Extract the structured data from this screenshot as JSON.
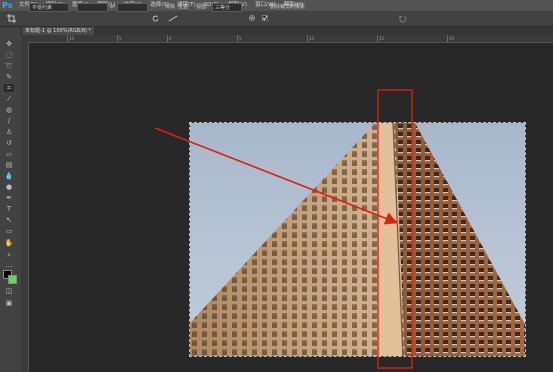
{
  "app": {
    "logo": "Ps"
  },
  "menu": [
    "文件(F)",
    "编辑(E)",
    "图像(I)",
    "图层(L)",
    "文字(Y)",
    "选择(S)",
    "滤镜(T)",
    "3D(D)",
    "视图(V)",
    "窗口(W)",
    "帮助(H)"
  ],
  "options": {
    "ratio_select": "不受约束",
    "swap_symbol": "⇄",
    "clear_label": "清除",
    "straighten_label": "拉直",
    "view_label": "视图:",
    "view_select": "三等分",
    "delete_pixels_label": "删除裁剪的像素"
  },
  "document": {
    "tab_title": "未标题-1 @ 100%(RGB/8) *"
  },
  "ruler": {
    "top_ticks": [
      "10",
      "5",
      "0",
      "5",
      "10",
      "15",
      "20"
    ]
  },
  "colors": {
    "foreground": "#000000",
    "background": "#55e04a",
    "annotation": "#e02010"
  }
}
